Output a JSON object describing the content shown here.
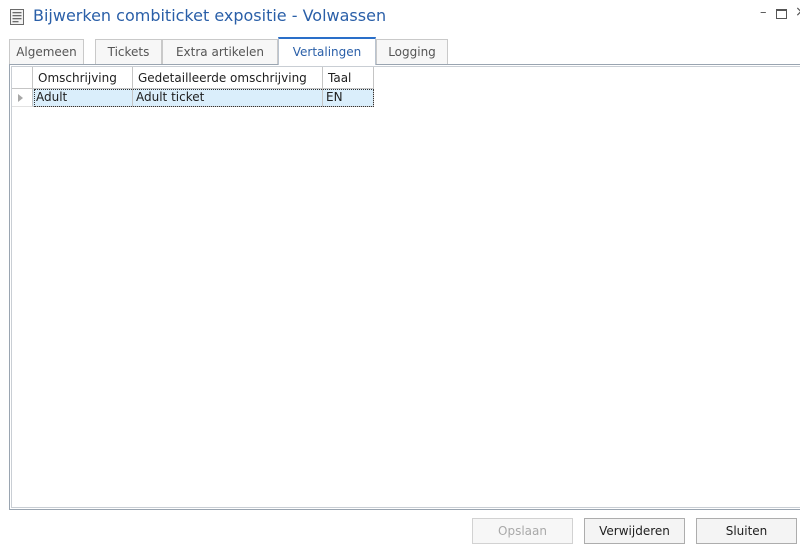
{
  "window": {
    "title": "Bijwerken combiticket expositie  - Volwassen",
    "minimize_glyph": "–",
    "close_glyph": "×"
  },
  "tabs": [
    {
      "label": "Algemeen",
      "active": false
    },
    {
      "label": "Tickets",
      "active": false
    },
    {
      "label": "Extra artikelen",
      "active": false
    },
    {
      "label": "Vertalingen",
      "active": true
    },
    {
      "label": "Logging",
      "active": false
    }
  ],
  "grid": {
    "columns": [
      "Omschrijving",
      "Gedetailleerde omschrijving",
      "Taal"
    ],
    "rows": [
      {
        "omschrijving": "Adult",
        "gedetailleerde_omschrijving": "Adult ticket",
        "taal": "EN",
        "selected": true
      }
    ]
  },
  "buttons": {
    "save": {
      "label": "Opslaan",
      "enabled": false
    },
    "delete": {
      "label": "Verwijderen",
      "enabled": true
    },
    "close": {
      "label": "Sluiten",
      "enabled": true
    }
  },
  "colors": {
    "title": "#2a5fa8",
    "active_tab_accent": "#2a6fc9",
    "selected_row": "#daeefb"
  }
}
